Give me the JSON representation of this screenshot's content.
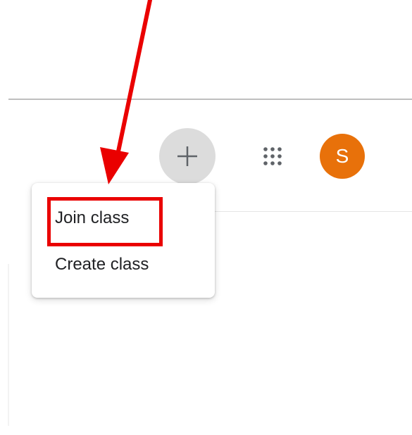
{
  "header": {
    "add_button": {
      "label": "+",
      "icon": "plus-icon"
    },
    "apps_button": {
      "icon": "apps-grid-icon"
    },
    "avatar": {
      "initial": "S",
      "color": "#e8710a"
    }
  },
  "menu": {
    "items": [
      {
        "label": "Join class"
      },
      {
        "label": "Create class"
      }
    ]
  },
  "annotation": {
    "highlight_color": "#ea0000",
    "arrow_color": "#ea0000",
    "arrow_icon": "arrow-icon"
  }
}
